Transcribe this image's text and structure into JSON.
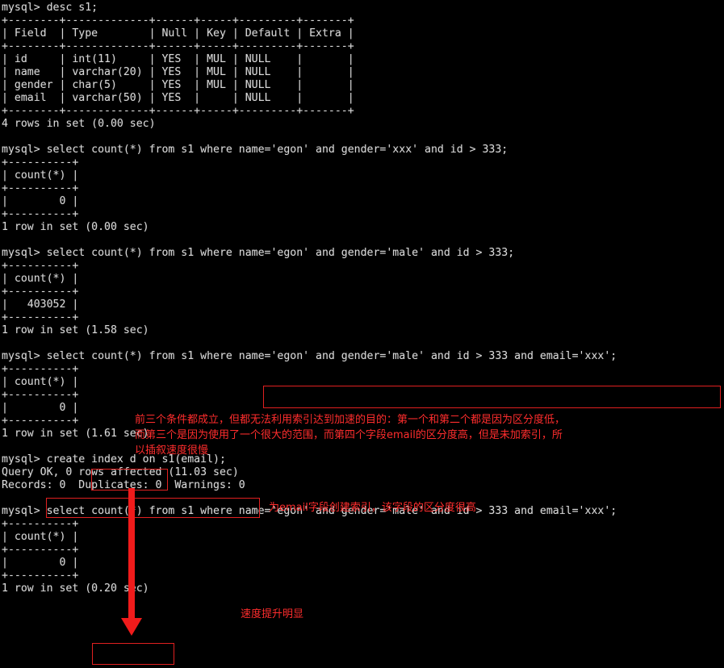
{
  "terminal": {
    "prompt": "mysql> ",
    "colors": {
      "background": "#000000",
      "foreground": "#d7d7d7",
      "annotation": "#ff2d2d",
      "annotation_box": "#e02020",
      "arrow": "#f01b1b"
    },
    "screen_text": "mysql> desc s1;\n+--------+-------------+------+-----+---------+-------+\n| Field  | Type        | Null | Key | Default | Extra |\n+--------+-------------+------+-----+---------+-------+\n| id     | int(11)     | YES  | MUL | NULL    |       |\n| name   | varchar(20) | YES  | MUL | NULL    |       |\n| gender | char(5)     | YES  | MUL | NULL    |       |\n| email  | varchar(50) | YES  |     | NULL    |       |\n+--------+-------------+------+-----+---------+-------+\n4 rows in set (0.00 sec)\n\nmysql> select count(*) from s1 where name='egon' and gender='xxx' and id > 333;\n+----------+\n| count(*) |\n+----------+\n|        0 |\n+----------+\n1 row in set (0.00 sec)\n\nmysql> select count(*) from s1 where name='egon' and gender='male' and id > 333;\n+----------+\n| count(*) |\n+----------+\n|   403052 |\n+----------+\n1 row in set (1.58 sec)\n\nmysql> select count(*) from s1 where name='egon' and gender='male' and id > 333 and email='xxx';\n+----------+\n| count(*) |\n+----------+\n|        0 |\n+----------+\n1 row in set (1.61 sec)\n\nmysql> create index d on s1(email);\nQuery OK, 0 rows affected (11.03 sec)\nRecords: 0  Duplicates: 0  Warnings: 0\n\nmysql> select count(*) from s1 where name='egon' and gender='male' and id > 333 and email='xxx';\n+----------+\n| count(*) |\n+----------+\n|        0 |\n+----------+\n1 row in set (0.20 sec)"
  },
  "commands": {
    "desc_table": "desc s1;",
    "query_gender_xxx": "select count(*) from s1 where name='egon' and gender='xxx' and id > 333;",
    "query_gender_male": "select count(*) from s1 where name='egon' and gender='male' and id > 333;",
    "query_with_email": "select count(*) from s1 where name='egon' and gender='male' and id > 333 and email='xxx';",
    "create_index": "create index d on s1(email);"
  },
  "schema_table": {
    "headers": [
      "Field",
      "Type",
      "Null",
      "Key",
      "Default",
      "Extra"
    ],
    "rows": [
      [
        "id",
        "int(11)",
        "YES",
        "MUL",
        "NULL",
        ""
      ],
      [
        "name",
        "varchar(20)",
        "YES",
        "MUL",
        "NULL",
        ""
      ],
      [
        "gender",
        "char(5)",
        "YES",
        "MUL",
        "NULL",
        ""
      ],
      [
        "email",
        "varchar(50)",
        "YES",
        "",
        "NULL",
        ""
      ]
    ],
    "footer": "4 rows in set (0.00 sec)"
  },
  "results": [
    {
      "header": "count(*)",
      "value": "0",
      "footer": "1 row in set (0.00 sec)",
      "timing": "0.00 sec"
    },
    {
      "header": "count(*)",
      "value": "403052",
      "footer": "1 row in set (1.58 sec)",
      "timing": "1.58 sec"
    },
    {
      "header": "count(*)",
      "value": "0",
      "footer": "1 row in set (1.61 sec)",
      "timing": "1.61 sec"
    },
    {
      "header": "count(*)",
      "value": "0",
      "footer": "1 row in set (0.20 sec)",
      "timing": "0.20 sec"
    }
  ],
  "index_creation": {
    "status": "Query OK, 0 rows affected (11.03 sec)",
    "records_line": "Records: 0  Duplicates: 0  Warnings: 0"
  },
  "annotations": {
    "slow_explanation_line1": "前三个条件都成立，但都无法利用索引达到加速的目的：第一个和第二个都是因为区分度低，",
    "slow_explanation_line2": "而第三个是因为使用了一个很大的范围，而第四个字段email的区分度高，但是未加索引，所",
    "slow_explanation_line3": "以插叙速度很慢",
    "create_index_note": "为email字段创建索引，该字段的区分度很高",
    "speedup_note": "速度提升明显"
  }
}
